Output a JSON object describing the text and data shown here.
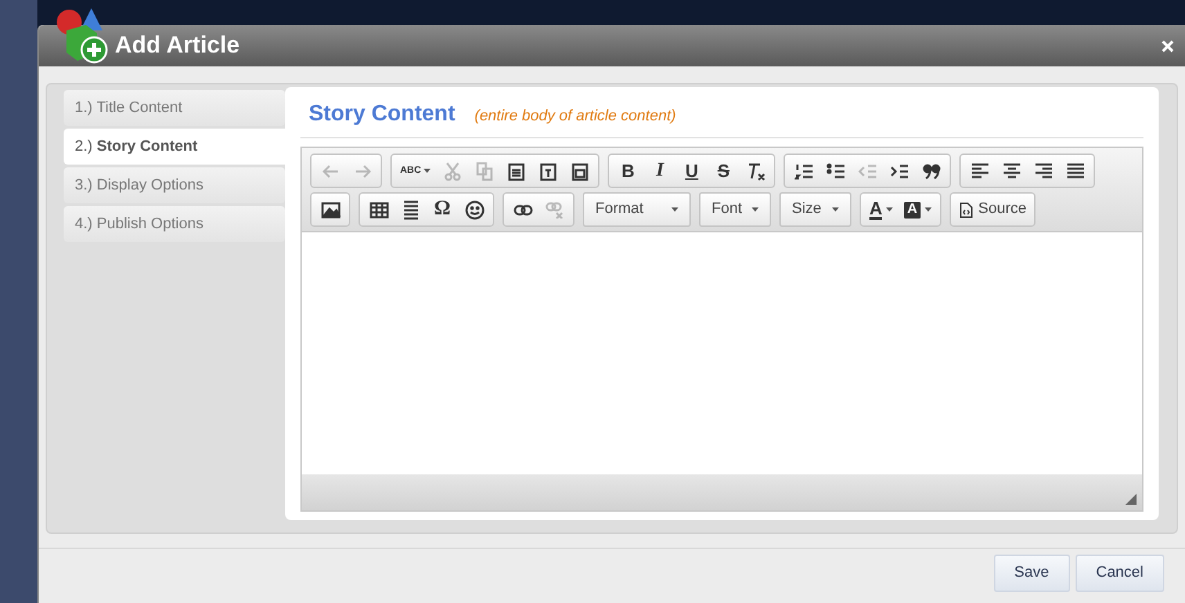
{
  "dialog": {
    "title": "Add Article"
  },
  "steps": [
    {
      "number": "1.)",
      "label": "Title Content",
      "selected": false
    },
    {
      "number": "2.)",
      "label": "Story Content",
      "selected": true
    },
    {
      "number": "3.)",
      "label": "Display Options",
      "selected": false
    },
    {
      "number": "4.)",
      "label": "Publish Options",
      "selected": false
    }
  ],
  "section": {
    "title": "Story Content",
    "note": "(entire body of article content)"
  },
  "toolbar": {
    "rows": [
      [
        {
          "kind": "group",
          "buttons": [
            {
              "kind": "undo",
              "disabled": true
            },
            {
              "kind": "redo",
              "disabled": true
            }
          ]
        },
        {
          "kind": "group",
          "buttons": [
            {
              "kind": "spellcheck",
              "glyph": "ABC",
              "disabled": false
            },
            {
              "kind": "cut",
              "disabled": true
            },
            {
              "kind": "copy",
              "disabled": true
            },
            {
              "kind": "paste",
              "disabled": false
            },
            {
              "kind": "paste-text",
              "disabled": false
            },
            {
              "kind": "paste-word",
              "disabled": false
            }
          ]
        },
        {
          "kind": "group",
          "buttons": [
            {
              "kind": "bold",
              "glyph": "B",
              "disabled": false
            },
            {
              "kind": "italic",
              "glyph": "I",
              "disabled": false
            },
            {
              "kind": "underline",
              "glyph": "U",
              "disabled": false
            },
            {
              "kind": "strike",
              "glyph": "S",
              "disabled": false
            },
            {
              "kind": "remove-format",
              "disabled": false
            }
          ]
        },
        {
          "kind": "group",
          "buttons": [
            {
              "kind": "numbered-list",
              "disabled": false
            },
            {
              "kind": "bullet-list",
              "disabled": false
            },
            {
              "kind": "outdent",
              "disabled": true
            },
            {
              "kind": "indent",
              "disabled": false
            },
            {
              "kind": "blockquote",
              "disabled": false
            }
          ]
        },
        {
          "kind": "group",
          "buttons": [
            {
              "kind": "align-left",
              "disabled": false
            },
            {
              "kind": "align-center",
              "disabled": false
            },
            {
              "kind": "align-right",
              "disabled": false
            },
            {
              "kind": "justify",
              "disabled": false
            }
          ]
        }
      ],
      [
        {
          "kind": "group",
          "buttons": [
            {
              "kind": "image",
              "disabled": false
            }
          ]
        },
        {
          "kind": "group",
          "buttons": [
            {
              "kind": "table",
              "disabled": false
            },
            {
              "kind": "horizontal-line",
              "disabled": false
            },
            {
              "kind": "special-char",
              "glyph": "Ω",
              "disabled": false
            },
            {
              "kind": "smiley",
              "disabled": false
            }
          ]
        },
        {
          "kind": "group",
          "buttons": [
            {
              "kind": "link",
              "disabled": false
            },
            {
              "kind": "unlink",
              "disabled": true
            }
          ]
        },
        {
          "kind": "combo",
          "label": "Format"
        },
        {
          "kind": "combo",
          "label": "Font"
        },
        {
          "kind": "combo",
          "label": "Size"
        },
        {
          "kind": "group",
          "buttons": [
            {
              "kind": "text-color",
              "glyph": "A",
              "disabled": false
            },
            {
              "kind": "background-color",
              "glyph": "A",
              "disabled": false
            }
          ]
        },
        {
          "kind": "group",
          "buttons": [
            {
              "kind": "source",
              "label": "Source",
              "disabled": false
            }
          ]
        }
      ]
    ]
  },
  "buttons": [
    {
      "label": "Save"
    },
    {
      "label": "Cancel"
    }
  ]
}
